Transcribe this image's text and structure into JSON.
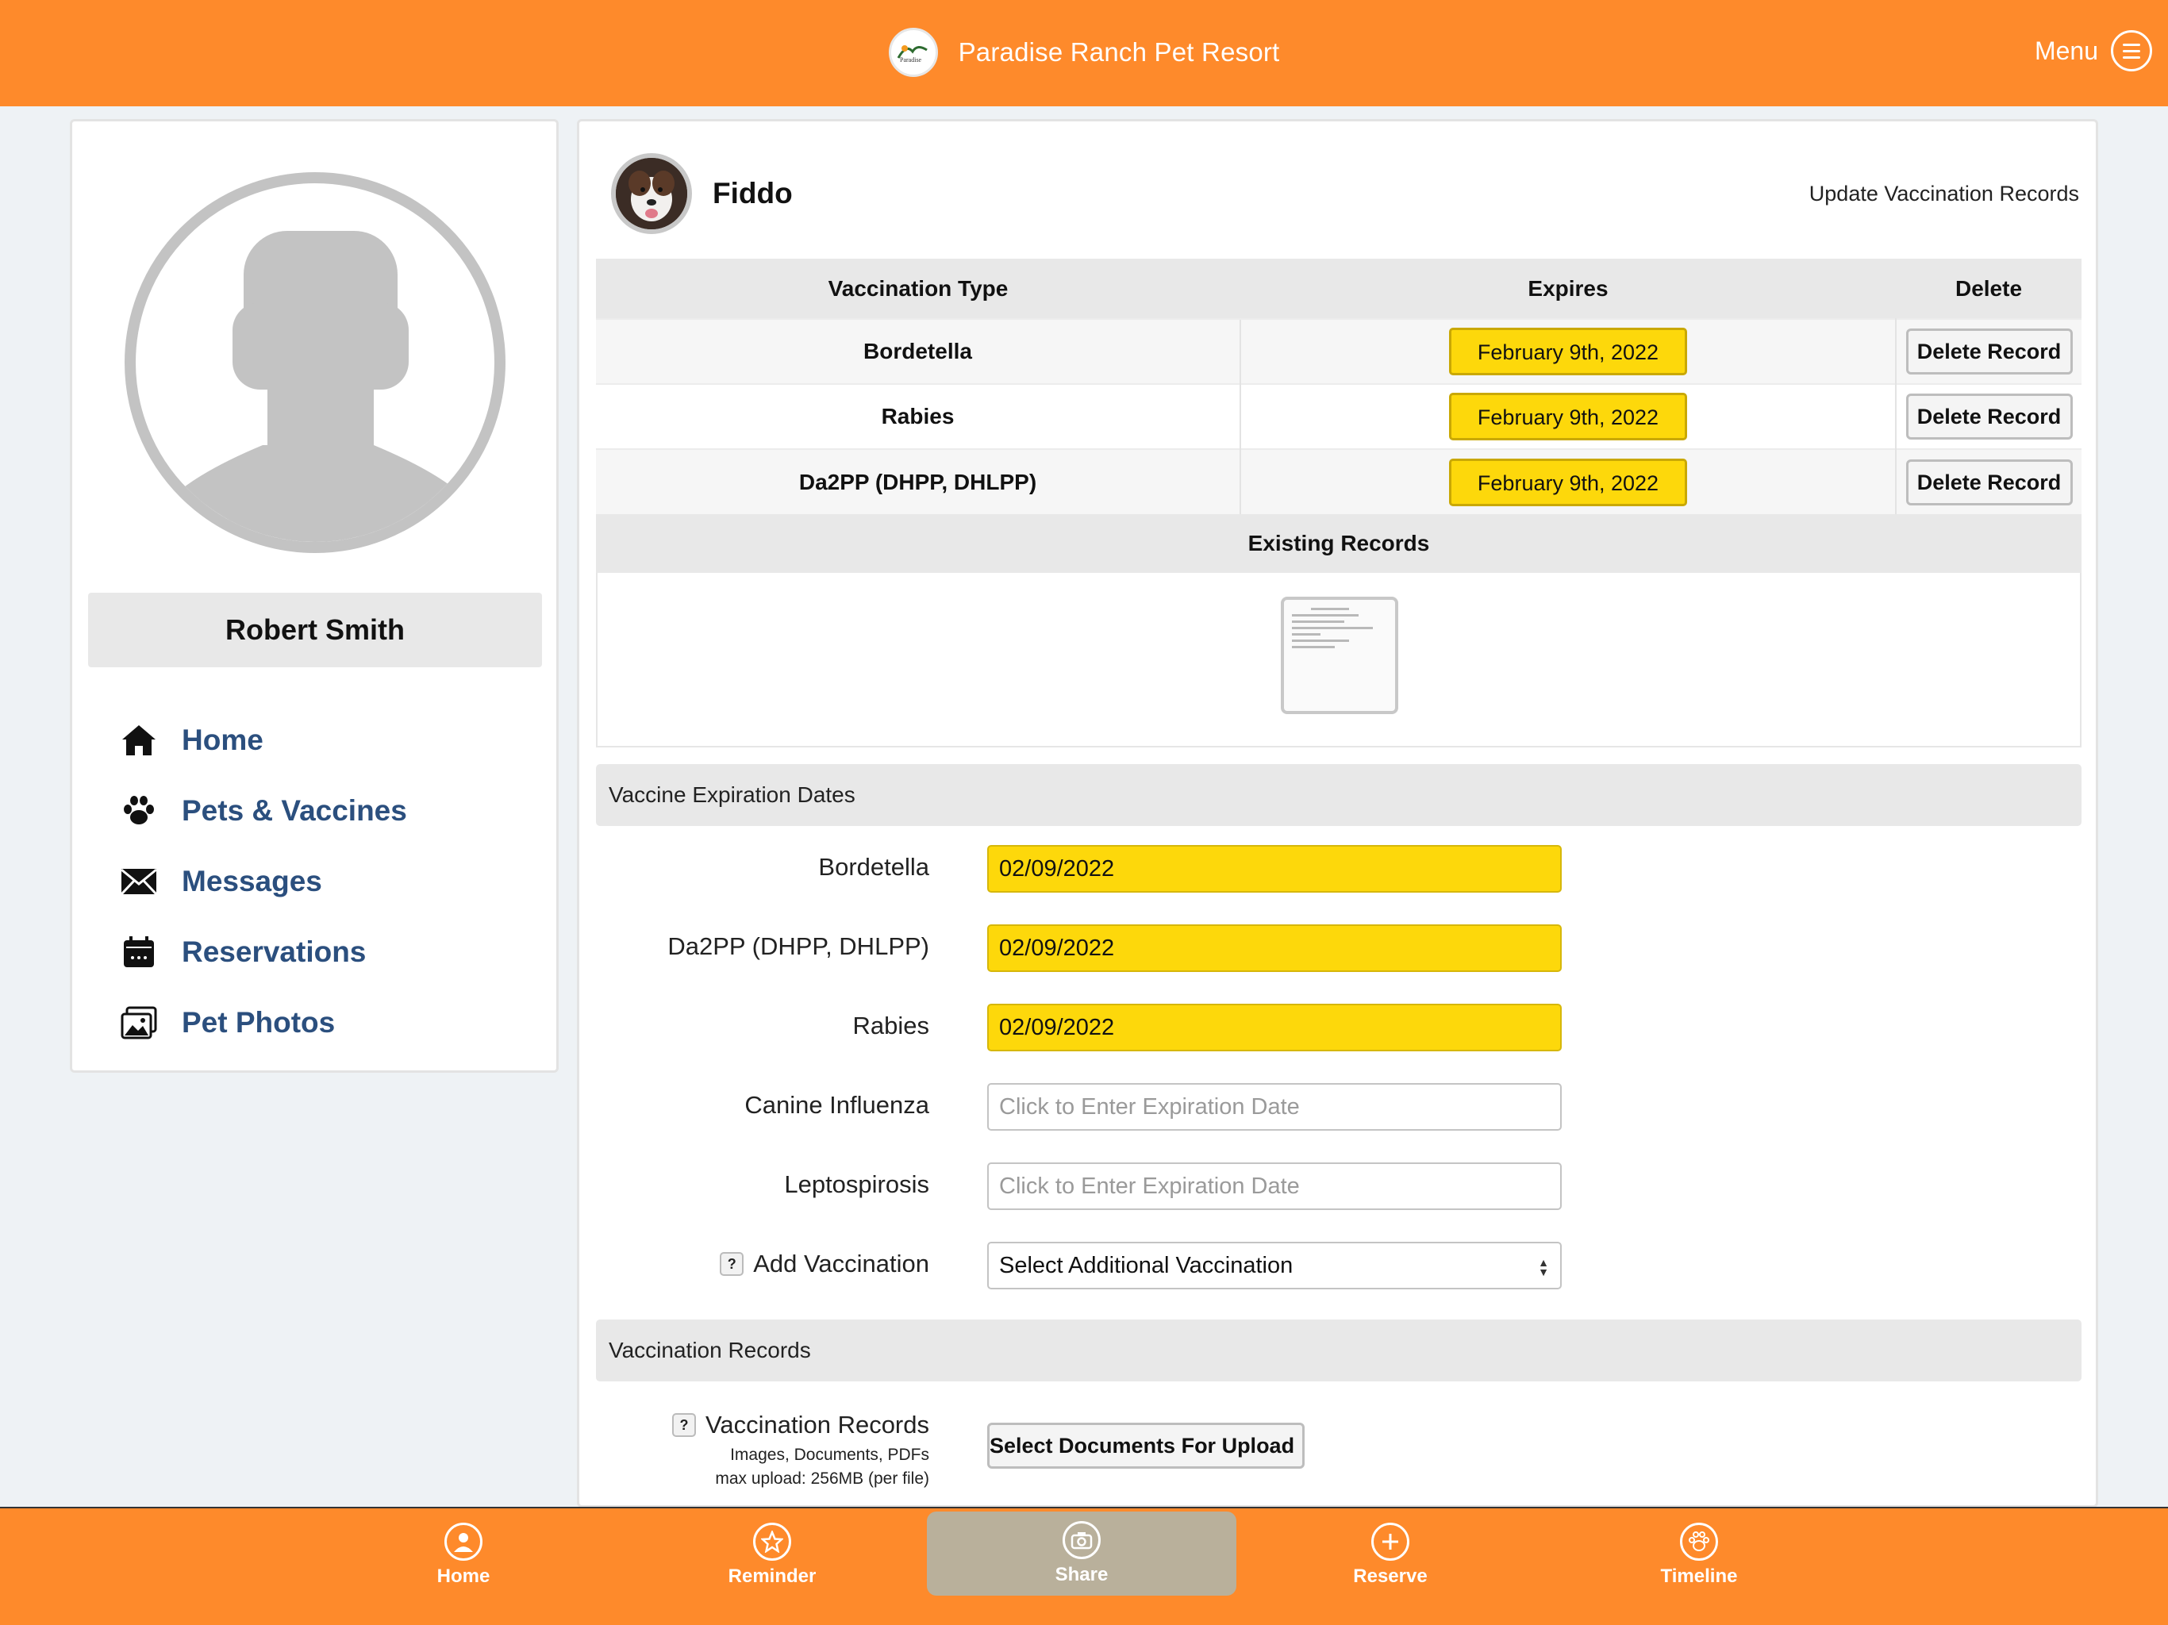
{
  "header": {
    "title": "Paradise Ranch Pet Resort",
    "menu_label": "Menu",
    "logo_icon": "resort-logo-icon"
  },
  "profile": {
    "name": "Robert Smith",
    "nav": [
      {
        "label": "Home",
        "icon": "home-icon"
      },
      {
        "label": "Pets & Vaccines",
        "icon": "paw-icon"
      },
      {
        "label": "Messages",
        "icon": "envelope-icon"
      },
      {
        "label": "Reservations",
        "icon": "calendar-icon"
      },
      {
        "label": "Pet Photos",
        "icon": "photos-icon"
      }
    ]
  },
  "pet": {
    "name": "Fiddo",
    "update_link": "Update Vaccination Records"
  },
  "vaccination_table": {
    "headers": [
      "Vaccination Type",
      "Expires",
      "Delete"
    ],
    "rows": [
      {
        "type": "Bordetella",
        "expires": "February 9th, 2022",
        "action": "Delete Record"
      },
      {
        "type": "Rabies",
        "expires": "February 9th, 2022",
        "action": "Delete Record"
      },
      {
        "type": "Da2PP (DHPP, DHLPP)",
        "expires": "February 9th, 2022",
        "action": "Delete Record"
      }
    ],
    "existing_records_title": "Existing Records"
  },
  "expiration_section": {
    "title": "Vaccine Expiration Dates",
    "fields": [
      {
        "label": "Bordetella",
        "value": "02/09/2022",
        "placeholder": ""
      },
      {
        "label": "Da2PP (DHPP, DHLPP)",
        "value": "02/09/2022",
        "placeholder": ""
      },
      {
        "label": "Rabies",
        "value": "02/09/2022",
        "placeholder": ""
      },
      {
        "label": "Canine Influenza",
        "value": "",
        "placeholder": "Click to Enter Expiration Date"
      },
      {
        "label": "Leptospirosis",
        "value": "",
        "placeholder": "Click to Enter Expiration Date"
      }
    ],
    "add_label": "Add Vaccination",
    "add_select_value": "Select Additional Vaccination",
    "help_glyph": "?"
  },
  "records_section": {
    "title": "Vaccination Records",
    "label": "Vaccination Records",
    "hint1": "Images, Documents, PDFs",
    "hint2": "max upload: 256MB (per file)",
    "upload_button": "Select Documents For Upload"
  },
  "tabbar": {
    "tabs": [
      {
        "label": "Home",
        "icon": "user-icon"
      },
      {
        "label": "Reminder",
        "icon": "star-icon"
      },
      {
        "label": "Share",
        "icon": "camera-icon"
      },
      {
        "label": "Reserve",
        "icon": "plus-icon"
      },
      {
        "label": "Timeline",
        "icon": "paw-icon"
      }
    ],
    "active_tab": "Share"
  },
  "colors": {
    "brand_orange": "#fe8a2b",
    "highlight_yellow": "#fdd80b",
    "nav_blue": "#2b4f7e",
    "active_tab_bg": "#b9b09b"
  }
}
